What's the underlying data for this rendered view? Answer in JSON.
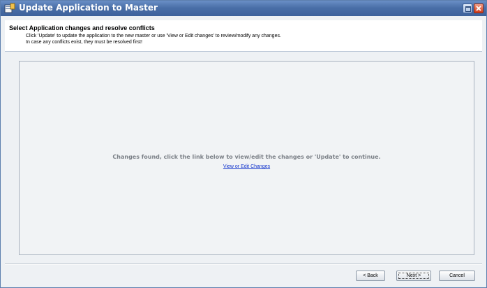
{
  "window": {
    "title": "Update Application to Master",
    "app_icon": "application-update-icon",
    "controls": {
      "maximize_icon": "maximize-icon",
      "close_icon": "close-icon"
    }
  },
  "header": {
    "title": "Select Application changes and resolve conflicts",
    "line1": "Click 'Update' to update the application to the new master or use 'View or Edit changes' to review/modify any changes.",
    "line2": "In case any conflicts exist, they must be resolved first!"
  },
  "main": {
    "message": "Changes found, click the link below to view/edit the changes or 'Update' to continue.",
    "link_label": "View or Edit Changes"
  },
  "footer": {
    "back_label": "< Back",
    "next_label": "Next >",
    "cancel_label": "Cancel"
  },
  "colors": {
    "title_bar": "#4a6fa8",
    "link": "#1133cc",
    "message_text": "#7a7f86"
  }
}
